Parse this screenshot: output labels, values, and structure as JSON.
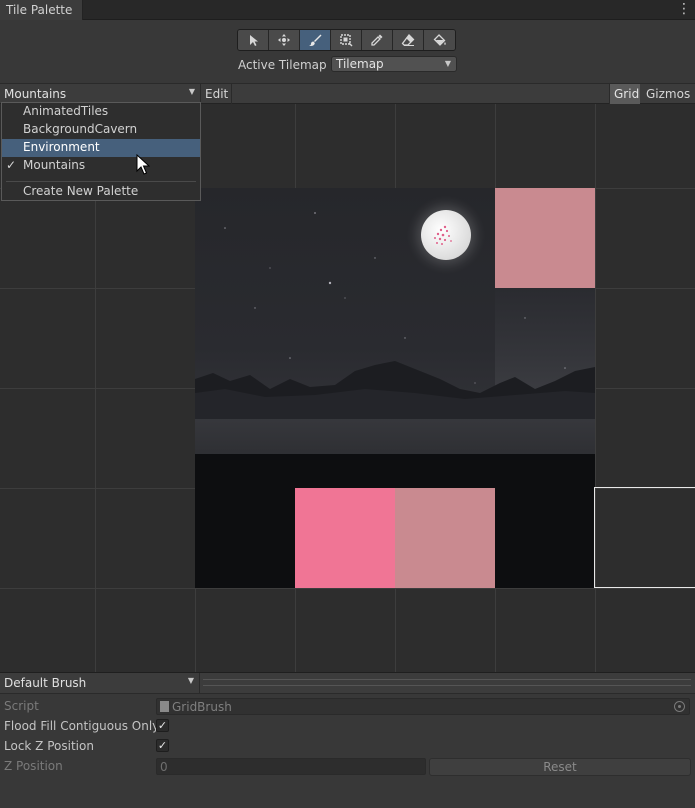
{
  "window": {
    "tab_title": "Tile Palette",
    "menu_glyph": "⋮"
  },
  "toolbar": {
    "tools": [
      {
        "name": "select-icon",
        "active": false
      },
      {
        "name": "move-icon",
        "active": false
      },
      {
        "name": "paint-brush-icon",
        "active": true
      },
      {
        "name": "box-fill-icon",
        "active": false
      },
      {
        "name": "picker-icon",
        "active": false
      },
      {
        "name": "eraser-icon",
        "active": false
      },
      {
        "name": "flood-fill-icon",
        "active": false
      }
    ],
    "active_tilemap_label": "Active Tilemap",
    "active_tilemap_value": "Tilemap"
  },
  "palette_bar": {
    "selected_palette": "Mountains",
    "edit_label": "Edit",
    "grid_label": "Grid",
    "gizmos_label": "Gizmos"
  },
  "palette_menu": {
    "items": [
      {
        "label": "AnimatedTiles",
        "checked": false,
        "highlighted": false
      },
      {
        "label": "BackgroundCavern",
        "checked": false,
        "highlighted": false
      },
      {
        "label": "Environment",
        "checked": false,
        "highlighted": true
      },
      {
        "label": "Mountains",
        "checked": true,
        "highlighted": false
      }
    ],
    "check_glyph": "✓",
    "create_label": "Create New Palette"
  },
  "tiles": {
    "colors": {
      "pink_light": "#c98a90",
      "pink_bright": "#f07595"
    }
  },
  "brush": {
    "selected_brush": "Default Brush",
    "script_label": "Script",
    "script_value": "GridBrush",
    "flood_fill_label": "Flood Fill Contiguous Only",
    "flood_fill_checked": true,
    "lock_z_label": "Lock Z Position",
    "lock_z_checked": true,
    "z_position_label": "Z Position",
    "z_position_value": "0",
    "reset_label": "Reset"
  },
  "colors": {
    "accent": "#46607c",
    "panel": "#383838",
    "canvas": "#2d2d2d"
  }
}
